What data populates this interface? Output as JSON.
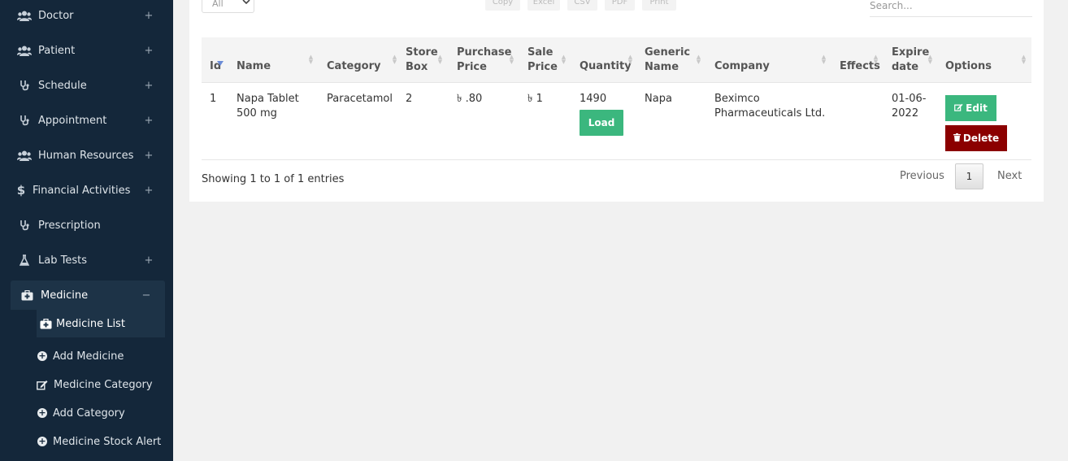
{
  "sidebar": {
    "items": [
      {
        "label": "Doctor",
        "icon": "users-icon",
        "toggle": "+"
      },
      {
        "label": "Patient",
        "icon": "users-icon",
        "toggle": "+"
      },
      {
        "label": "Schedule",
        "icon": "stethoscope-icon",
        "toggle": "+"
      },
      {
        "label": "Appointment",
        "icon": "stethoscope-icon",
        "toggle": "+"
      },
      {
        "label": "Human Resources",
        "icon": "users-icon",
        "toggle": "+"
      },
      {
        "label": "Financial Activities",
        "icon": "dollar-icon",
        "toggle": "+"
      },
      {
        "label": "Prescription",
        "icon": "stethoscope-icon",
        "toggle": ""
      },
      {
        "label": "Lab Tests",
        "icon": "flask-icon",
        "toggle": "+"
      },
      {
        "label": "Medicine",
        "icon": "medkit-icon",
        "toggle": "−"
      }
    ],
    "sub_items": [
      {
        "label": "Medicine List",
        "icon": "medkit-icon"
      },
      {
        "label": "Add Medicine",
        "icon": "plus-circle-icon"
      },
      {
        "label": "Medicine Category",
        "icon": "edit-icon"
      },
      {
        "label": "Add Category",
        "icon": "plus-circle-icon"
      },
      {
        "label": "Medicine Stock Alert",
        "icon": "plus-circle-icon"
      }
    ]
  },
  "toolbar": {
    "length_value": "All",
    "export": [
      "Copy",
      "Excel",
      "CSV",
      "PDF",
      "Print"
    ],
    "search_placeholder": "Search..."
  },
  "table": {
    "headers": {
      "id": "Id",
      "name": "Name",
      "category": "Category",
      "store_box_1": "Store",
      "store_box_2": "Box",
      "purchase_1": "Purchase",
      "purchase_2": "Price",
      "sale_1": "Sale",
      "sale_2": "Price",
      "quantity": "Quantity",
      "generic_1": "Generic",
      "generic_2": "Name",
      "company": "Company",
      "effects": "Effects",
      "expire_1": "Expire",
      "expire_2": "date",
      "options": "Options"
    },
    "row": {
      "id": "1",
      "name_1": "Napa Tablet",
      "name_2": "500 mg",
      "category": "Paracetamol",
      "store_box": "2",
      "purchase_price": "৳ .80",
      "sale_price": "৳ 1",
      "quantity": "1490",
      "load_label": "Load",
      "generic": "Napa",
      "company_1": "Beximco",
      "company_2": "Pharmaceuticals Ltd.",
      "effects": "",
      "expire_1": "01-06-",
      "expire_2": "2022",
      "edit_label": "Edit",
      "delete_label": "Delete"
    }
  },
  "footer": {
    "info": "Showing 1 to 1 of 1 entries",
    "previous": "Previous",
    "page": "1",
    "next": "Next"
  },
  "colors": {
    "sidebar_bg": "#14273a",
    "green": "#3bb77e",
    "dark_red": "#8b0000"
  }
}
